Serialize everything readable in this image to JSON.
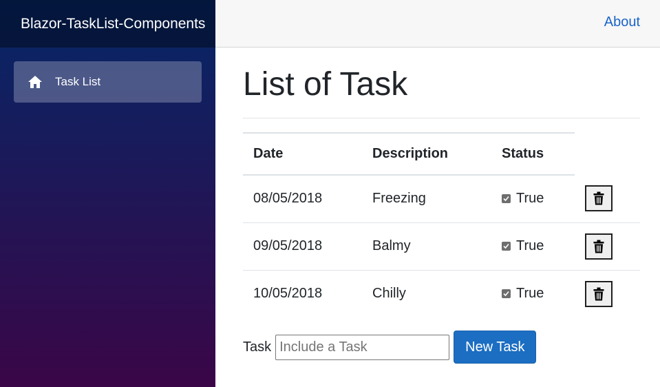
{
  "app": {
    "brand": "Blazor-TaskList-Components"
  },
  "sidebar": {
    "items": [
      {
        "label": "Task List",
        "icon": "home-icon"
      }
    ]
  },
  "top_row": {
    "about_label": "About"
  },
  "page": {
    "title": "List of Task"
  },
  "table": {
    "headers": {
      "date": "Date",
      "description": "Description",
      "status": "Status"
    },
    "rows": [
      {
        "date": "08/05/2018",
        "description": "Freezing",
        "status": "True"
      },
      {
        "date": "09/05/2018",
        "description": "Balmy",
        "status": "True"
      },
      {
        "date": "10/05/2018",
        "description": "Chilly",
        "status": "True"
      }
    ]
  },
  "form": {
    "label": "Task",
    "placeholder": "Include a Task",
    "value": "",
    "button_label": "New Task"
  },
  "colors": {
    "accent": "#1b6ec2",
    "link": "#1a63c9",
    "sidebar_top": "#052767",
    "sidebar_bottom": "#3a0647"
  }
}
